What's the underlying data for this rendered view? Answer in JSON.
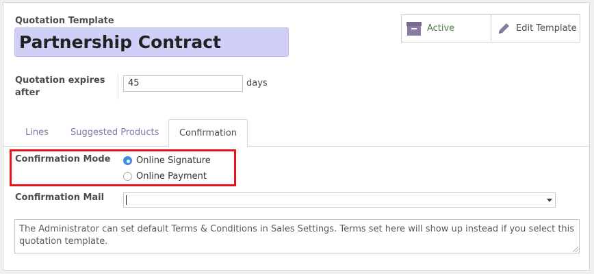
{
  "header": {
    "title_label": "Quotation Template",
    "template_name": "Partnership Contract"
  },
  "stat_buttons": {
    "active_label": "Active",
    "edit_label": "Edit Template"
  },
  "expiry": {
    "label": "Quotation expires after",
    "value": "45",
    "unit": "days"
  },
  "tabs": [
    {
      "label": "Lines"
    },
    {
      "label": "Suggested Products"
    },
    {
      "label": "Confirmation",
      "active": true
    }
  ],
  "confirmation": {
    "mode_label": "Confirmation Mode",
    "options": [
      {
        "label": "Online Signature",
        "selected": true
      },
      {
        "label": "Online Payment",
        "selected": false
      }
    ],
    "mail_label": "Confirmation Mail",
    "mail_value": ""
  },
  "notes": {
    "text": "The Administrator can set default Terms & Conditions in Sales Settings. Terms set here will show up instead if you select this quotation template."
  },
  "colors": {
    "title_bg": "#cfcff8",
    "tab_inactive": "#7c7bad",
    "highlight_box": "#e8121b",
    "radio_on": "#3a8ee6"
  },
  "icons": {
    "active": "archive-box-icon",
    "edit": "pencil-icon"
  }
}
